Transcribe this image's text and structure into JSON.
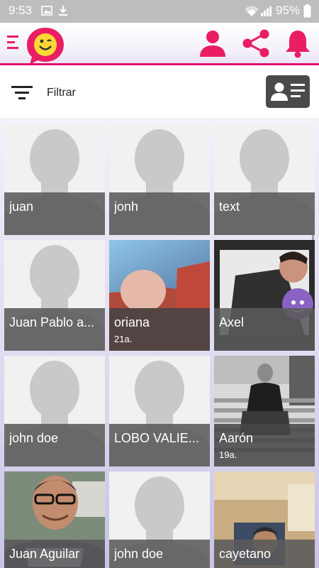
{
  "status_bar": {
    "time": "9:53",
    "battery": "95%",
    "icons": [
      "image-notification-icon",
      "download-icon",
      "wifi-icon",
      "signal-icon",
      "battery-icon"
    ]
  },
  "app_bar": {
    "icons": [
      "menu-icon",
      "app-logo",
      "profile-icon",
      "share-icon",
      "notifications-icon"
    ],
    "accent_color": "#e91e63"
  },
  "filter": {
    "label": "Filtrar",
    "icons": [
      "filter-icon",
      "contact-card-icon"
    ]
  },
  "profiles": [
    {
      "name": "juan",
      "age": "",
      "photo": "placeholder"
    },
    {
      "name": "jonh",
      "age": "",
      "photo": "placeholder"
    },
    {
      "name": "text",
      "age": "",
      "photo": "placeholder"
    },
    {
      "name": "Juan Pablo a...",
      "age": "",
      "photo": "placeholder"
    },
    {
      "name": "oriana",
      "age": "21a.",
      "photo": "photo"
    },
    {
      "name": "Axel",
      "age": "",
      "photo": "photo"
    },
    {
      "name": "john doe",
      "age": "",
      "photo": "placeholder"
    },
    {
      "name": "LOBO VALIE...",
      "age": "",
      "photo": "placeholder"
    },
    {
      "name": "Aarón",
      "age": "19a.",
      "photo": "photo"
    },
    {
      "name": "Juan Aguilar",
      "age": "",
      "photo": "photo"
    },
    {
      "name": "john doe",
      "age": "",
      "photo": "placeholder"
    },
    {
      "name": "cayetano",
      "age": "",
      "photo": "photo"
    }
  ]
}
